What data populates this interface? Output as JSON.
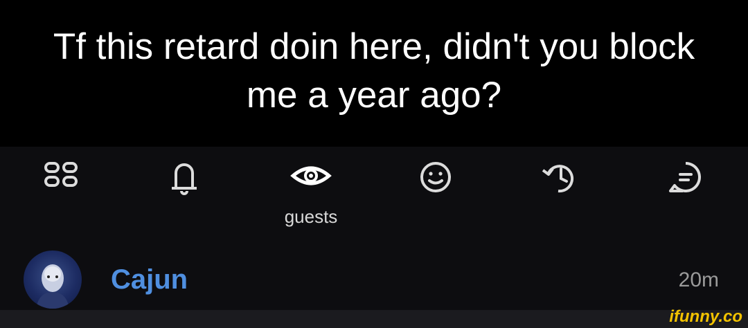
{
  "caption": {
    "text": "Tf this retard doin here, didn't you block me a year ago?"
  },
  "nav": {
    "items": [
      {
        "icon": "grid-icon",
        "label": ""
      },
      {
        "icon": "bell-icon",
        "label": ""
      },
      {
        "icon": "eye-icon",
        "label": "guests"
      },
      {
        "icon": "smiley-icon",
        "label": ""
      },
      {
        "icon": "history-icon",
        "label": ""
      },
      {
        "icon": "chat-icon",
        "label": ""
      }
    ],
    "active_label": "guests"
  },
  "guest": {
    "name": "Cajun",
    "time": "20m"
  },
  "watermark": {
    "text": "ifunny.co"
  },
  "colors": {
    "username": "#4f8fe0",
    "icon": "#dcdcdc",
    "watermark": "#f3c300"
  }
}
